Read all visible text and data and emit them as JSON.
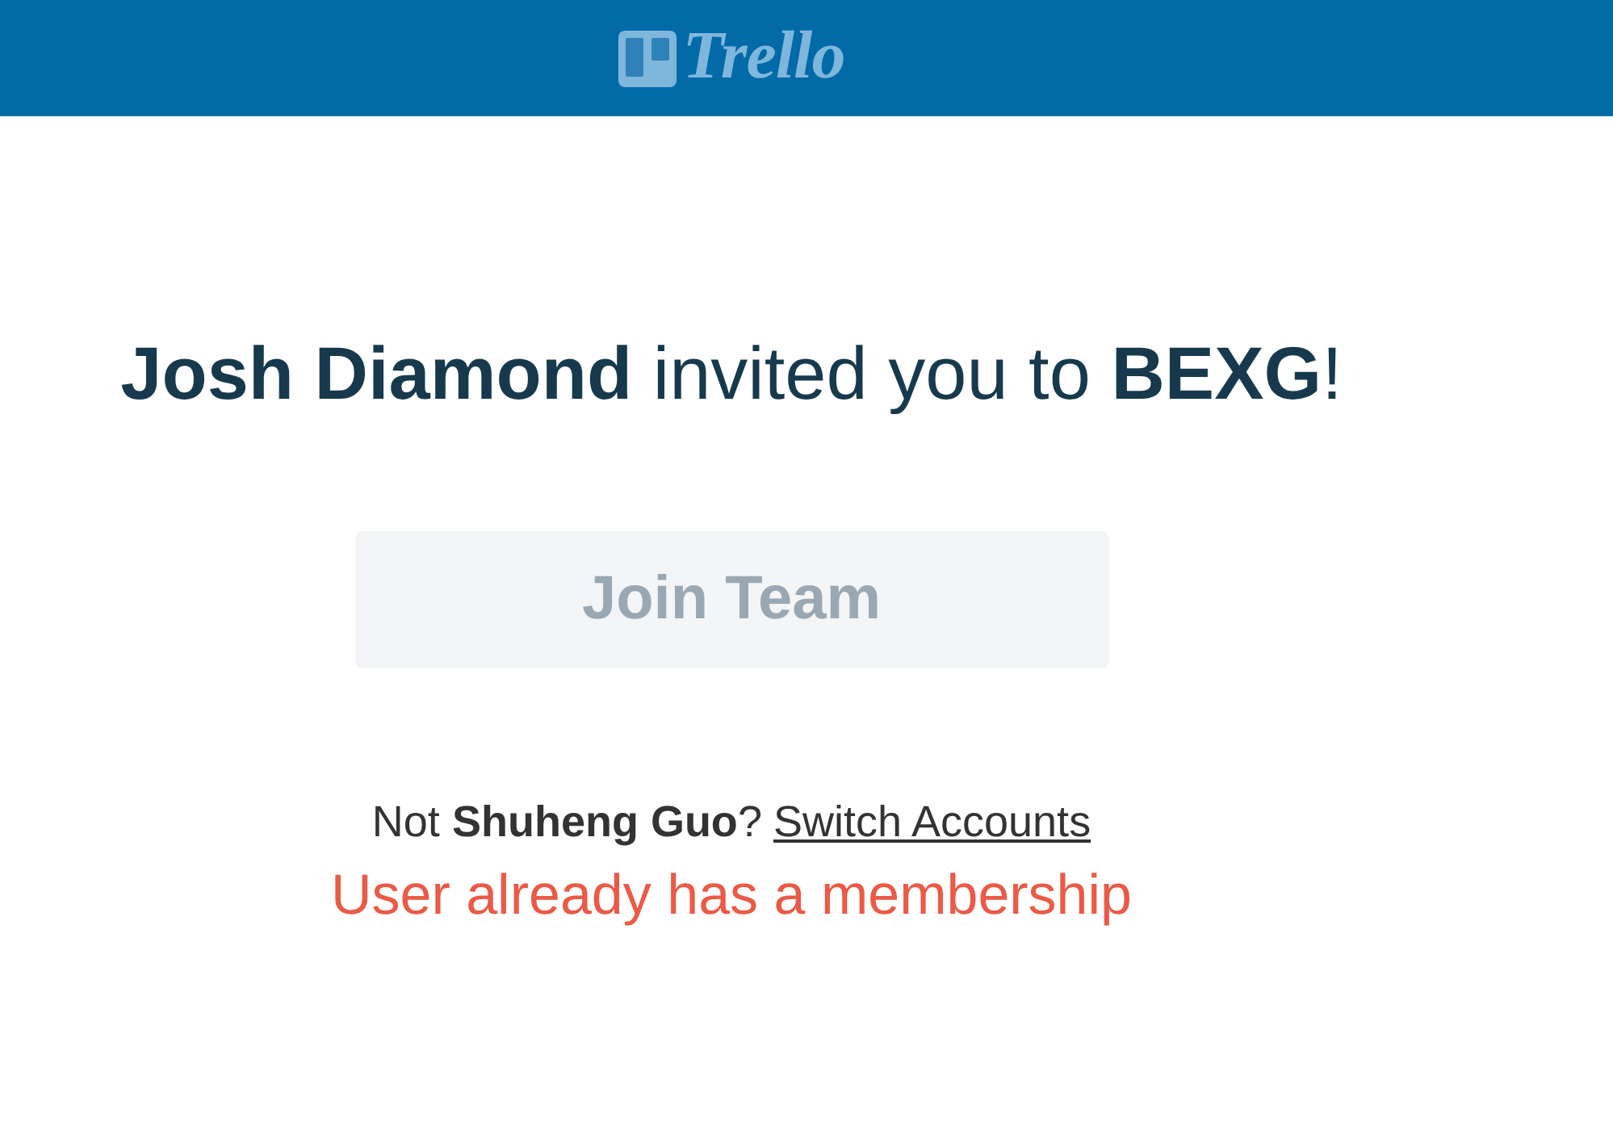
{
  "header": {
    "logo_text": "Trello"
  },
  "invitation": {
    "text": "**Josh Diamond** invited you to **BEXG**!"
  },
  "join_button": {
    "label": "Join Team",
    "disabled": true
  },
  "account_prompt": {
    "text": "Not **Shuheng Guo**?",
    "link": "Switch Accounts"
  },
  "error_message": "User already has a membership"
}
